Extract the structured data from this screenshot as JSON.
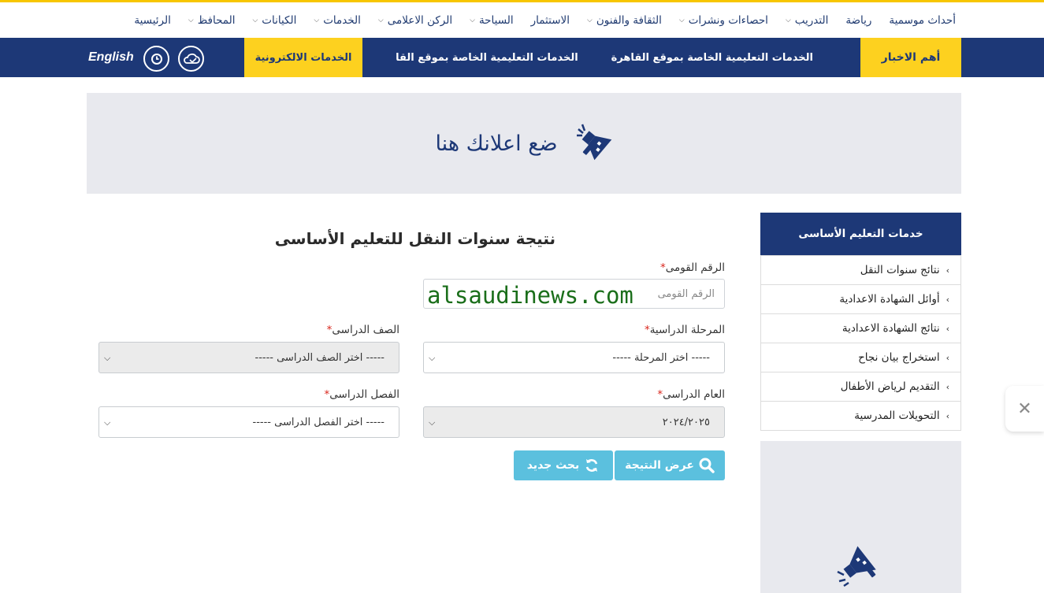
{
  "nav": {
    "items": [
      {
        "label": "الرئيسية",
        "dropdown": false
      },
      {
        "label": "المحافظ",
        "dropdown": true
      },
      {
        "label": "الكيانات",
        "dropdown": true
      },
      {
        "label": "الخدمات",
        "dropdown": true
      },
      {
        "label": "الركن الاعلامى",
        "dropdown": true
      },
      {
        "label": "السياحة",
        "dropdown": true
      },
      {
        "label": "الاستثمار",
        "dropdown": false
      },
      {
        "label": "الثقافة والفنون",
        "dropdown": true
      },
      {
        "label": "احصاءات ونشرات",
        "dropdown": true
      },
      {
        "label": "التدريب",
        "dropdown": true
      },
      {
        "label": "رياضة",
        "dropdown": false
      },
      {
        "label": "أحداث موسمية",
        "dropdown": false
      }
    ]
  },
  "newsbar": {
    "label": "أهم الاخبار",
    "ticker": [
      "الخدمات التعليمية الخاصة بموقع القاهرة",
      "الخدمات التعليمية الخاصة بموقع القا"
    ],
    "eservices": "الخدمات الالكترونية",
    "language": "English"
  },
  "ad_banner": {
    "text": "ضع اعلانك هنا"
  },
  "sidebar": {
    "title": "خدمات التعليم الأساسى",
    "items": [
      "نتائج سنوات النقل",
      "أوائل الشهادة الاعدادية",
      "نتائج الشهادة الاعدادية",
      "استخراج بيان نجاح",
      "التقديم لرياض الأطفال",
      "التحويلات المدرسية"
    ]
  },
  "form": {
    "title": "نتيجة سنوات النقل للتعليم الأساسى",
    "national_id": {
      "label": "الرقم القومى",
      "placeholder": "الرقم القومى"
    },
    "stage": {
      "label": "المرحلة الدراسية",
      "value": "----- اختر المرحلة -----"
    },
    "grade": {
      "label": "الصف الدراسى",
      "value": "----- اختر الصف الدراسى -----"
    },
    "year": {
      "label": "العام الدراسى",
      "value": "٢٠٢٤/٢٠٢٥"
    },
    "term": {
      "label": "الفصل الدراسى",
      "value": "----- اختر الفصل الدراسى -----"
    },
    "required_mark": "*",
    "submit_label": "عرض النتيجة",
    "reset_label": "بحث جديد"
  },
  "watermark": "alsaudinews.com",
  "colors": {
    "navy": "#1d3877",
    "yellow": "#fdd11f",
    "button": "#5bc0de"
  }
}
